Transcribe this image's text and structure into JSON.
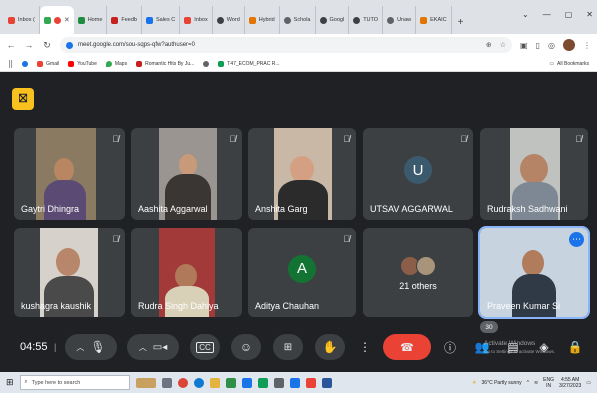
{
  "browser": {
    "tabs": [
      {
        "label": "Inbox (",
        "color": "#ea4335"
      },
      {
        "label": "",
        "color": "#34a853",
        "active": true
      },
      {
        "label": "Home",
        "color": "#1e8e3e"
      },
      {
        "label": "Feedb",
        "color": "#c5221f"
      },
      {
        "label": "Sales C",
        "color": "#1a73e8"
      },
      {
        "label": "Inbox",
        "color": "#ea4335"
      },
      {
        "label": "Word",
        "color": "#3c4043"
      },
      {
        "label": "Hybrid",
        "color": "#e37400"
      },
      {
        "label": "Schola",
        "color": "#5f6368"
      },
      {
        "label": "Googl",
        "color": "#3c4043"
      },
      {
        "label": "TUTO",
        "color": "#3c4043"
      },
      {
        "label": "Unaw",
        "color": "#5f6368"
      },
      {
        "label": "EKAIC",
        "color": "#e37400"
      }
    ],
    "new_tab": "+",
    "url": "meet.google.com/sou-sqps-qfw?authuser=0",
    "bookmarks": [
      {
        "label": "Gmail",
        "color": "#ea4335"
      },
      {
        "label": "YouTube",
        "color": "#ff0000"
      },
      {
        "label": "Maps",
        "color": "#34a853"
      },
      {
        "label": "Romantic Hits By Ju...",
        "color": "#c5221f"
      },
      {
        "label": "",
        "color": "#5f6368"
      },
      {
        "label": "T47_ECOM_PRAC R...",
        "color": "#0f9d58"
      }
    ],
    "all_bookmarks": "All Bookmarks"
  },
  "participants": [
    {
      "name": "Gaytri Dhingra",
      "muted": true
    },
    {
      "name": "Aashita Aggarwal",
      "muted": true
    },
    {
      "name": "Anshita Garg",
      "muted": true
    },
    {
      "name": "UTSAV AGGARWAL",
      "muted": true,
      "initial": "U",
      "avatar_color": "#3b5a6e"
    },
    {
      "name": "Rudraksh Sadhwani",
      "muted": true
    },
    {
      "name": "kushagra kaushik",
      "muted": true
    },
    {
      "name": "Rudra Singh Dahiya",
      "muted": true
    },
    {
      "name": "Aditya Chauhan",
      "muted": true,
      "initial": "A",
      "avatar_color": "#137333"
    },
    {
      "name": "",
      "others_label": "21 others"
    },
    {
      "name": "Praveen Kumar Si",
      "active": true
    }
  ],
  "controls": {
    "clock": "04:55",
    "separator": "|",
    "people_count": "30"
  },
  "watermark": {
    "line1": "Activate Windows",
    "line2": "Go to Settings to activate Windows."
  },
  "taskbar": {
    "search_placeholder": "Type here to search",
    "weather": "36°C  Partly sunny",
    "lang": "ENG",
    "region": "IN",
    "time": "4:55 AM",
    "date": "3/27/2023"
  }
}
